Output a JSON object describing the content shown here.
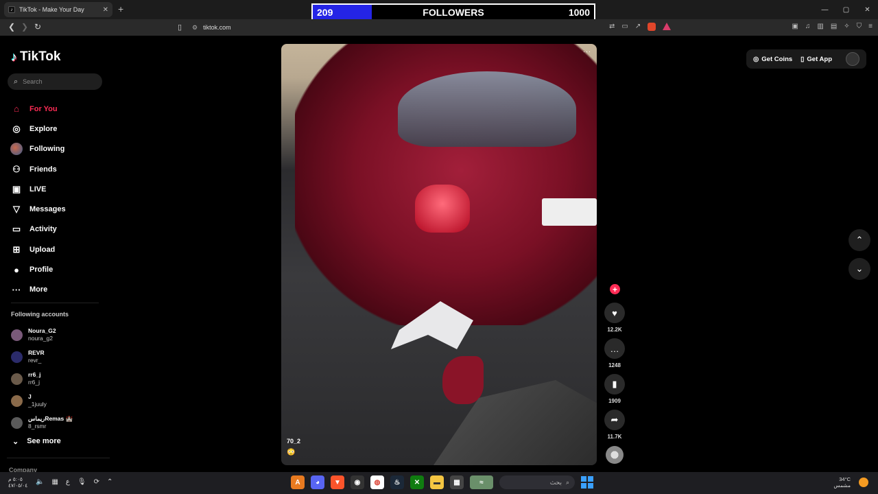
{
  "browser": {
    "tab_title": "TikTok - Make Your Day",
    "tab_close": "✕",
    "new_tab": "+",
    "url": "tiktok.com",
    "controls": {
      "minimize": "—",
      "maximize": "▢",
      "close": "✕"
    }
  },
  "follower_goal": {
    "current": "209",
    "label": "FOLLOWERS",
    "goal": "1000",
    "progress_fraction": 0.209,
    "fill_color": "#2424e6"
  },
  "sidebar": {
    "logo": "TikTok",
    "search_placeholder": "Search",
    "nav": [
      {
        "label": "For You",
        "icon": "home-icon",
        "glyph": "⌂",
        "active": true
      },
      {
        "label": "Explore",
        "icon": "compass-icon",
        "glyph": "◎"
      },
      {
        "label": "Following",
        "icon": "following-avatar",
        "glyph": ""
      },
      {
        "label": "Friends",
        "icon": "friends-icon",
        "glyph": "⚇"
      },
      {
        "label": "LIVE",
        "icon": "live-icon",
        "glyph": "▣"
      },
      {
        "label": "Messages",
        "icon": "messages-icon",
        "glyph": "▽"
      },
      {
        "label": "Activity",
        "icon": "activity-icon",
        "glyph": "▭"
      },
      {
        "label": "Upload",
        "icon": "upload-icon",
        "glyph": "⊞"
      },
      {
        "label": "Profile",
        "icon": "profile-avatar",
        "glyph": "●"
      },
      {
        "label": "More",
        "icon": "more-icon",
        "glyph": "···"
      }
    ],
    "following_header": "Following accounts",
    "accounts": [
      {
        "name": "Noura_G2",
        "handle": "noura_g2"
      },
      {
        "name": "REVR",
        "handle": "revr_"
      },
      {
        "name": "rr6_j",
        "handle": "rr6_j"
      },
      {
        "name": "J",
        "handle": "_1juuly"
      },
      {
        "name": "ريماسRemas 🏰",
        "handle": "8_rsmr"
      }
    ],
    "see_more": "See more",
    "company": "Company"
  },
  "video": {
    "username": "70_2",
    "emoji": "😳",
    "menu": "···"
  },
  "actions": {
    "follow": "+",
    "likes": "12.2K",
    "comments": "1248",
    "saves": "1909",
    "shares": "11.7K"
  },
  "topright": {
    "get_coins": "Get Coins",
    "get_app": "Get App"
  },
  "taskbar": {
    "time": "٥:٠٥ م",
    "date": "٤٧/٠٥/٠٤",
    "search": "بحث",
    "temperature": "34°C",
    "weather": "مشمس"
  }
}
